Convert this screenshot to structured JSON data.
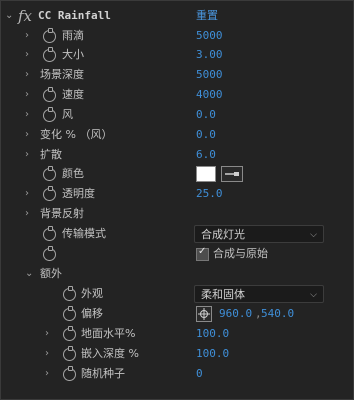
{
  "effect": {
    "fx_symbol": "fx",
    "name": "CC Rainfall",
    "reset_label": "重置"
  },
  "props": {
    "drops": {
      "label": "雨滴",
      "value": "5000"
    },
    "size": {
      "label": "大小",
      "value": "3.00"
    },
    "scene_depth": {
      "label": "场景深度",
      "value": "5000"
    },
    "speed": {
      "label": "速度",
      "value": "4000"
    },
    "wind": {
      "label": "风",
      "value": "0.0"
    },
    "variation": {
      "label": "变化 % （风）",
      "value": "0.0"
    },
    "spread": {
      "label": "扩散",
      "value": "6.0"
    },
    "color": {
      "label": "颜色",
      "value": "#ffffff"
    },
    "opacity": {
      "label": "透明度",
      "value": "25.0"
    },
    "bg_reflect": {
      "label": "背景反射"
    },
    "transfer_mode": {
      "label": "传输模式",
      "value": "合成灯光"
    },
    "composite": {
      "label": "合成与原始",
      "checked": true
    },
    "extras": {
      "label": "额外"
    },
    "appearance": {
      "label": "外观",
      "value": "柔和固体"
    },
    "offset": {
      "label": "偏移",
      "x": "960.0",
      "y": "540.0"
    },
    "ground_level": {
      "label": "地面水平%",
      "value": "100.0"
    },
    "embed_depth": {
      "label": "嵌入深度 %",
      "value": "100.0"
    },
    "random_seed": {
      "label": "随机种子",
      "value": "0"
    }
  },
  "icons": [
    "chevron-down-icon",
    "chevron-right-icon",
    "stopwatch-icon",
    "eyedropper-icon",
    "crosshair-icon",
    "dropdown-arrow-icon",
    "checkbox-check-icon"
  ]
}
